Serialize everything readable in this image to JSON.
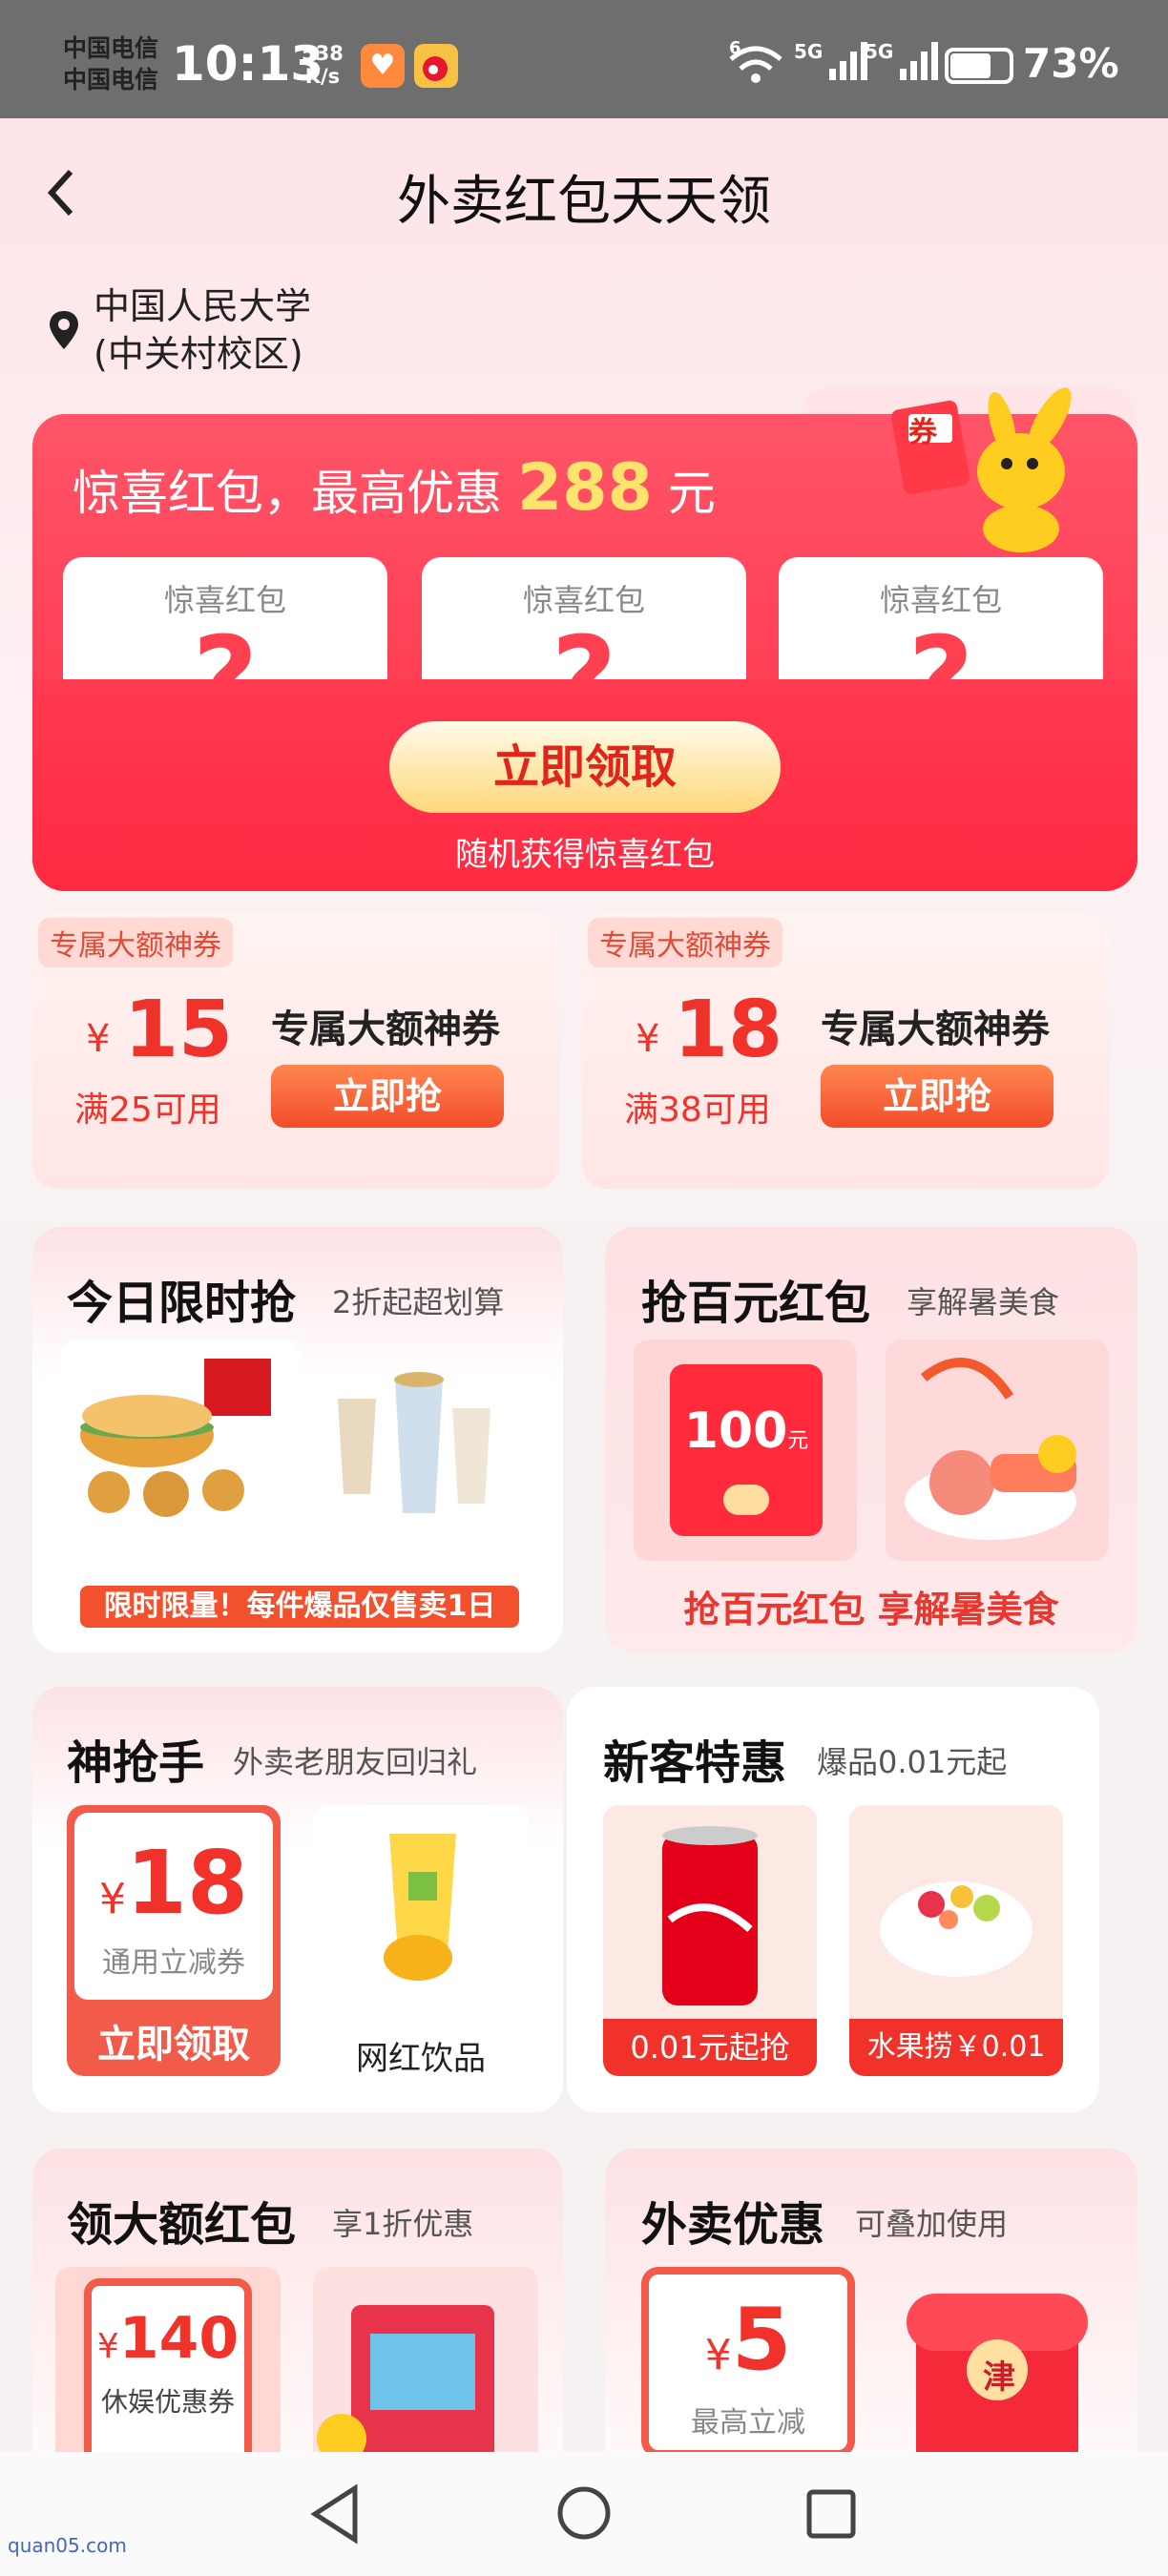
{
  "status_bar": {
    "carrier_1": "中国电信",
    "carrier_2": "中国电信",
    "time": "10:13",
    "speed_value": "538",
    "speed_unit": "K/s",
    "signal_1": "6",
    "signal_2": "5G",
    "signal_3": "5G",
    "battery": "73%"
  },
  "header": {
    "title": "外卖红包天天领"
  },
  "location": {
    "line1": "中国人民大学",
    "line2": "(中关村校区)"
  },
  "surprise": {
    "headline": "惊喜红包，最高优惠",
    "amount": "288",
    "unit": "元",
    "ticket_badge": "券",
    "box_label": "惊喜红包",
    "box_mark": "?",
    "claim_button": "立即领取",
    "subtext": "随机获得惊喜红包"
  },
  "coupons": [
    {
      "tag": "专属大额神券",
      "currency": "¥",
      "amount": "15",
      "condition": "满25可用",
      "name": "专属大额神券",
      "button": "立即抢"
    },
    {
      "tag": "专属大额神券",
      "currency": "¥",
      "amount": "18",
      "condition": "满38可用",
      "name": "专属大额神券",
      "button": "立即抢"
    }
  ],
  "flash_sale": {
    "title": "今日限时抢",
    "subtitle": "2折起超划算",
    "banner": "限时限量！每件爆品仅售卖1日"
  },
  "hundred": {
    "title": "抢百元红包",
    "subtitle": "享解暑美食",
    "envelope_amount": "100",
    "envelope_unit": "元",
    "banner": "抢百元红包 享解暑美食"
  },
  "sharpshooter": {
    "title": "神抢手",
    "subtitle": "外卖老朋友回归礼",
    "currency": "¥",
    "amount": "18",
    "coupon_label": "通用立减券",
    "button": "立即领取",
    "drink_label": "网红饮品"
  },
  "new_customer": {
    "title": "新客特惠",
    "subtitle": "爆品0.01元起",
    "item1_label": "0.01元起抢",
    "item2_label": "水果捞￥0.01"
  },
  "big_red": {
    "title": "领大额红包",
    "subtitle": "享1折优惠",
    "currency": "¥",
    "amount": "140",
    "coupon_label": "休娱优惠券"
  },
  "takeout": {
    "title": "外卖优惠",
    "subtitle": "可叠加使用",
    "currency": "¥",
    "amount": "5",
    "label": "最高立减",
    "bag_mark": "津"
  },
  "watermark": "quan05.com",
  "colors": {
    "accent_red": "#f0322a",
    "panel_red": "#ff2d45",
    "gold": "#ffe36d"
  }
}
